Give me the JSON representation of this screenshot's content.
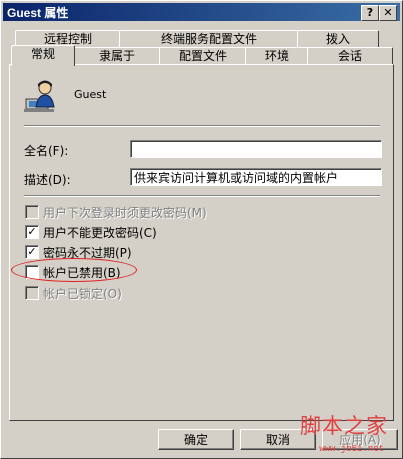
{
  "window": {
    "title": "Guest 属性",
    "help_btn": "?",
    "close_btn": "✕"
  },
  "tabs_back": [
    "远程控制",
    "终端服务配置文件",
    "拨入"
  ],
  "tabs_front": [
    "常规",
    "隶属于",
    "配置文件",
    "环境",
    "会话"
  ],
  "active_tab": "常规",
  "user": {
    "name": "Guest",
    "icon": "user-icon"
  },
  "fields": {
    "fullname_label": "全名(F):",
    "fullname_value": "",
    "desc_label": "描述(D):",
    "desc_value": "供来宾访问计算机或访问域的内置帐户"
  },
  "checks": [
    {
      "label": "用户下次登录时须更改密码(M)",
      "checked": false,
      "disabled": true
    },
    {
      "label": "用户不能更改密码(C)",
      "checked": true,
      "disabled": false
    },
    {
      "label": "密码永不过期(P)",
      "checked": true,
      "disabled": false
    },
    {
      "label": "帐户已禁用(B)",
      "checked": false,
      "disabled": false
    },
    {
      "label": "帐户已锁定(O)",
      "checked": false,
      "disabled": true
    }
  ],
  "buttons": {
    "ok": "确定",
    "cancel": "取消",
    "apply": "应用(A)"
  },
  "watermark": {
    "text": "脚本之家",
    "url": "www.jb51.net"
  }
}
